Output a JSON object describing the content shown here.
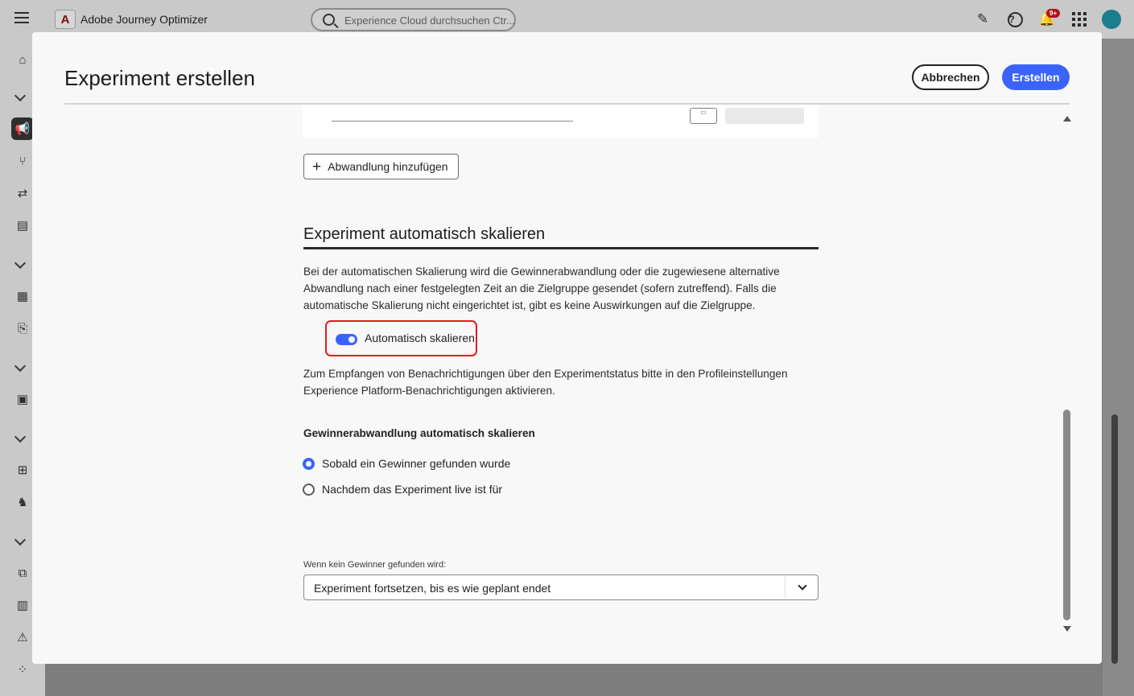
{
  "app": {
    "title": "Adobe Journey Optimizer",
    "search_placeholder": "Experience Cloud durchsuchen Ctr...",
    "notifications_badge": "9+",
    "logo_letter": "A"
  },
  "modal": {
    "title": "Experiment erstellen",
    "cancel_label": "Abbrechen",
    "create_label": "Erstellen"
  },
  "content": {
    "add_variant_label": "Abwandlung hinzufügen",
    "section_title": "Experiment automatisch skalieren",
    "description": "Bei der automatischen Skalierung wird die Gewinnerabwandlung oder die zugewiesene alternative Abwandlung nach einer festgelegten Zeit an die Zielgruppe gesendet (sofern zutreffend). Falls die automatische Skalierung nicht eingerichtet ist, gibt es keine Auswirkungen auf die Zielgruppe.",
    "toggle_label": "Automatisch skalieren",
    "toggle_on": true,
    "notice": "Zum Empfangen von Benachrichtigungen über den Experimentstatus bitte in den Profileinstellungen Experience Platform-Benachrichtigungen aktivieren.",
    "sub_heading": "Gewinnerabwandlung automatisch skalieren",
    "radio_options": [
      {
        "label": "Sobald ein Gewinner gefunden wurde",
        "checked": true
      },
      {
        "label": "Nachdem das Experiment live ist für",
        "checked": false
      }
    ],
    "no_winner_label": "Wenn kein Gewinner gefunden wird:",
    "no_winner_value": "Experiment fortsetzen, bis es wie geplant endet"
  },
  "colors": {
    "accent": "#3b63fb",
    "highlight": "#e11d1d",
    "badge": "#b2121b"
  }
}
